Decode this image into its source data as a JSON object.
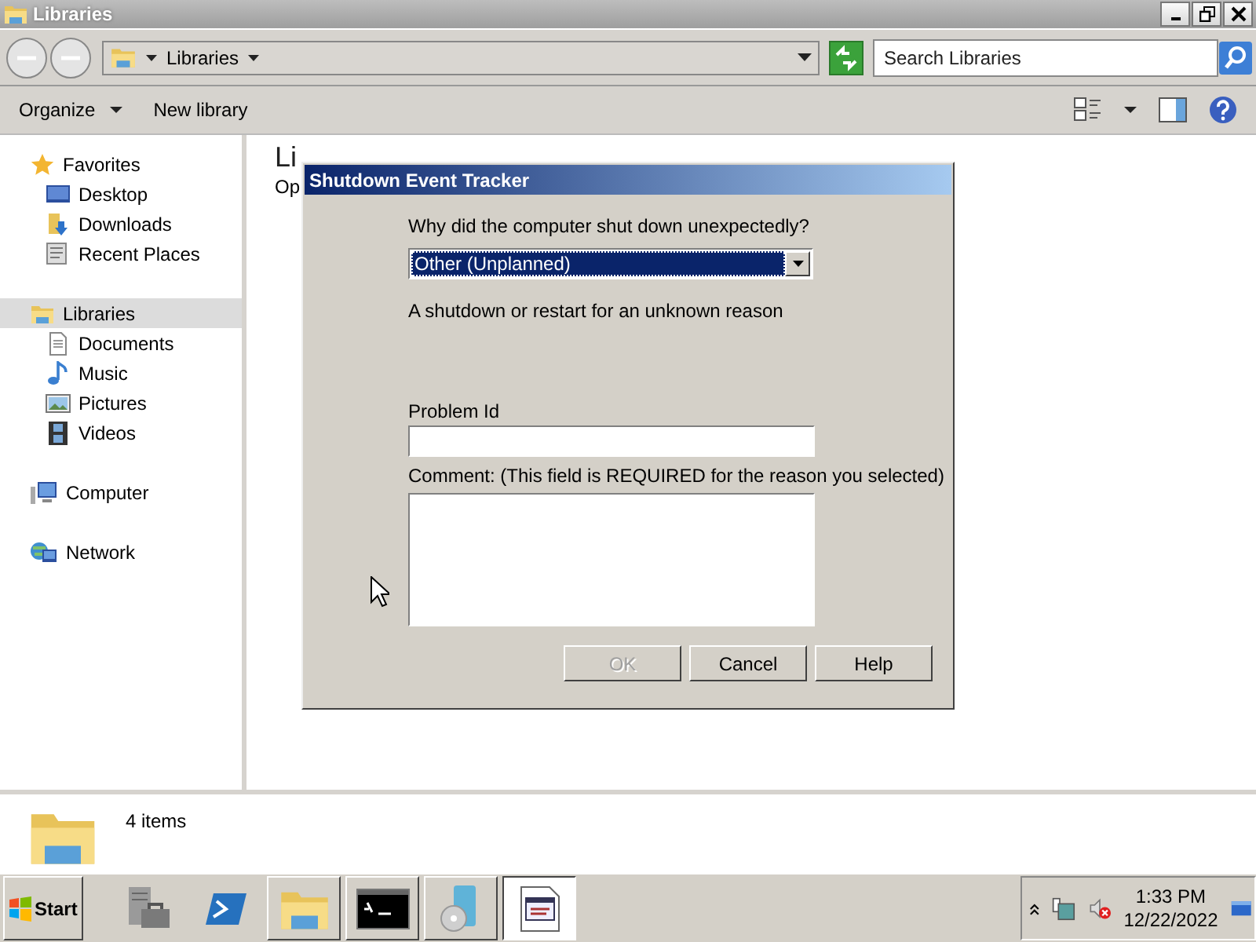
{
  "window": {
    "title": "Libraries"
  },
  "address_bar": {
    "path": "Libraries"
  },
  "search": {
    "placeholder": "Search Libraries"
  },
  "toolbar": {
    "items": [
      {
        "label": "Organize",
        "kind": "menu"
      },
      {
        "label": "New library",
        "kind": "button"
      }
    ]
  },
  "navigation": [
    {
      "label": "Favorites",
      "selected": false,
      "children": [
        {
          "label": "Desktop",
          "selected": false
        },
        {
          "label": "Downloads",
          "selected": false
        },
        {
          "label": "Recent Places",
          "selected": false
        }
      ]
    },
    {
      "label": "Libraries",
      "selected": true,
      "children": [
        {
          "label": "Documents",
          "selected": false
        },
        {
          "label": "Music",
          "selected": false
        },
        {
          "label": "Pictures",
          "selected": false
        },
        {
          "label": "Videos",
          "selected": false
        }
      ]
    },
    {
      "label": "Computer",
      "selected": false
    },
    {
      "label": "Network",
      "selected": false
    }
  ],
  "content": {
    "heading": "Li",
    "subtitle": "Op"
  },
  "details": {
    "count": "4 items"
  },
  "dialog": {
    "title": "Shutdown Event Tracker",
    "question": "Why did the computer shut down unexpectedly?",
    "reason": {
      "value": "Other (Unplanned)"
    },
    "description": "A shutdown or restart for an unknown reason",
    "problem_id": {
      "label": "Problem Id"
    },
    "comment": {
      "label": "Comment: (This field is REQUIRED for the reason you selected)"
    },
    "buttons": [
      {
        "label": "OK",
        "disabled": true
      },
      {
        "label": "Cancel",
        "disabled": false
      },
      {
        "label": "Help",
        "disabled": false
      }
    ]
  },
  "taskbar": {
    "start": "Start",
    "items": [
      {
        "running": false,
        "selected": false
      },
      {
        "running": false,
        "selected": false
      },
      {
        "running": true,
        "selected": false
      },
      {
        "running": true,
        "selected": false
      },
      {
        "running": true,
        "selected": false
      },
      {
        "running": true,
        "selected": true
      }
    ]
  },
  "tray": {
    "time": "1:33 PM",
    "date": "12/22/2022"
  }
}
